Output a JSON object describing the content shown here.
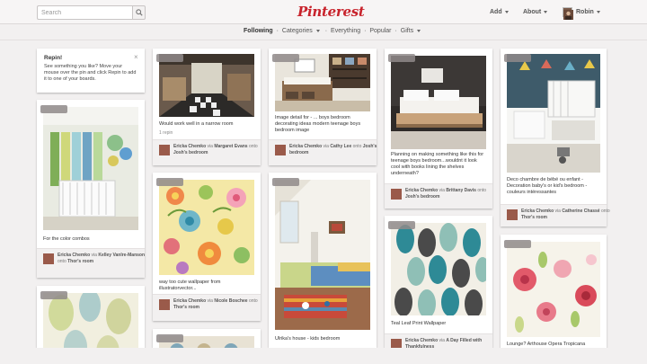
{
  "header": {
    "search_placeholder": "Search",
    "logo": "Pinterest",
    "add_label": "Add",
    "about_label": "About",
    "user_name": "Robin"
  },
  "subnav": {
    "following": "Following",
    "sep1": "·",
    "categories": "Categories",
    "sep2": "·",
    "everything": "Everything",
    "sep3": "·",
    "popular": "Popular",
    "sep4": "·",
    "gifts": "Gifts"
  },
  "repin_tip": {
    "title": "Repin!",
    "body": "See something you like? Move your mouse over the pin and click Repin to add it to one of your boards.",
    "close": "×"
  },
  "pins": [
    {
      "desc": "For the color combos",
      "user": "Ericka Chemko",
      "via": "Kelley Vanlre-Manson",
      "board": "Thor's room"
    },
    {
      "desc": "Would work well in a narrow room",
      "repins": "1 repin",
      "user": "Ericka Chemko",
      "via": "Margaret Evans",
      "board": "Josh's bedroom"
    },
    {
      "desc": "way too cute wallpaper from illustratorvector...",
      "user": "Ericka Chemko",
      "via": "Nicole Boschee",
      "board": "Thor's room"
    },
    {
      "desc": "Image detail for - ... boys bedroom decorating ideas modern teenage boys bedroom image",
      "user": "Ericka Chemko",
      "via": "Cathy Lee",
      "board": "Josh's bedroom"
    },
    {
      "desc": "Ulrika's house - kids bedroom"
    },
    {
      "desc": "Planning on making something like this for teenage boys bedroom...wouldnt it look cool with books lining the shelves underneath?",
      "user": "Ericka Chemko",
      "via": "Brittany Davis",
      "board": "Josh's bedroom"
    },
    {
      "desc": "Teal Leaf Print Wallpaper",
      "user": "Ericka Chemko",
      "via": "A Day Filled with Thankfulness"
    },
    {
      "desc": "Deco chambre de bébé ou enfant - Decoration baby's or kid's bedroom - couleurs intéressantes",
      "user": "Ericka Chemko",
      "via": "Catherine Chassé",
      "board": "Thor's room"
    },
    {
      "desc": "Lounge? Arthouse Opera Tropicana"
    }
  ],
  "words": {
    "via": "via",
    "onto": "onto"
  },
  "colors": {
    "brand": "#c8232c",
    "background": "#f2f0f0"
  }
}
